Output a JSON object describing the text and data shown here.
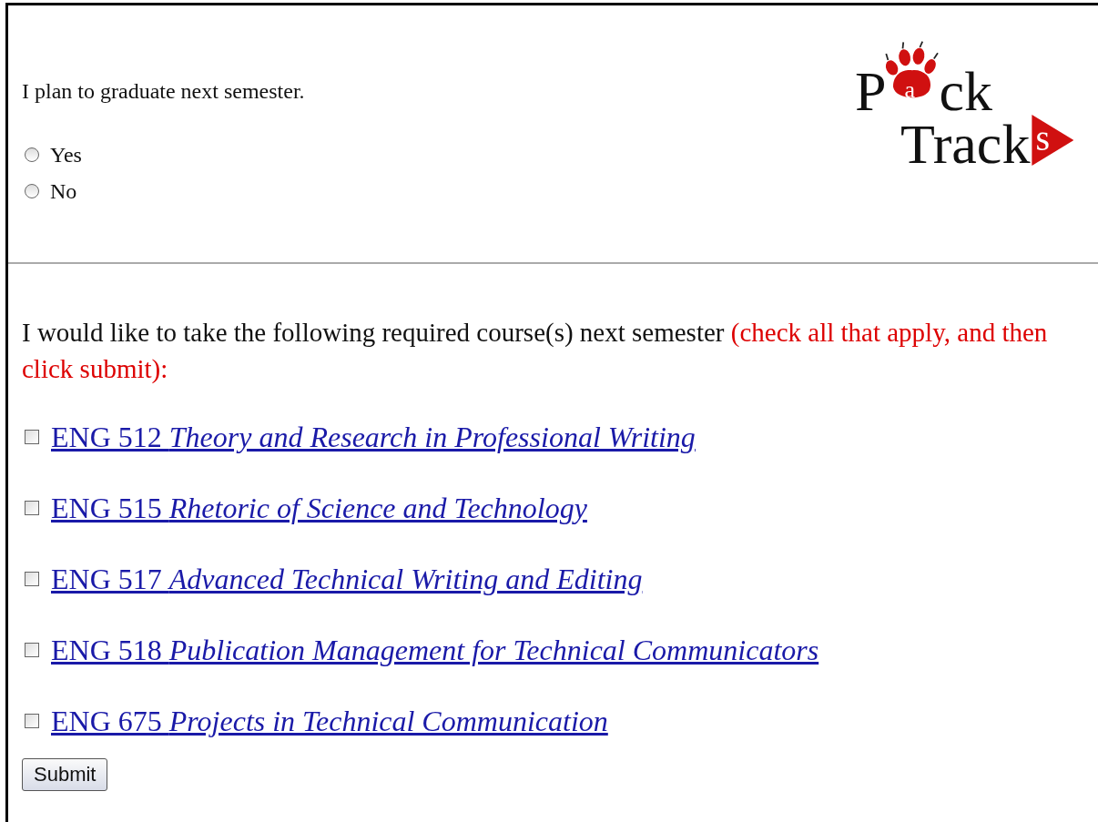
{
  "question": {
    "text": "I plan to graduate next semester.",
    "options": [
      {
        "label": "Yes",
        "selected": false
      },
      {
        "label": "No",
        "selected": false
      }
    ]
  },
  "logo": {
    "line_1": [
      "P",
      "a",
      "ck"
    ],
    "line_2": [
      "Track",
      "s"
    ]
  },
  "course_prompt": {
    "text": "I would like to take the following required course(s) next semester",
    "note": "(check all that apply, and then click submit):"
  },
  "courses": [
    {
      "code": "ENG 512",
      "title": "Theory and Research in Professional Writing",
      "checked": false
    },
    {
      "code": "ENG 515",
      "title": "Rhetoric of Science and Technology",
      "checked": false
    },
    {
      "code": "ENG 517",
      "title": "Advanced Technical Writing and Editing",
      "checked": false
    },
    {
      "code": "ENG 518",
      "title": "Publication Management for Technical Communicators",
      "checked": false
    },
    {
      "code": "ENG 675",
      "title": "Projects in Technical Communication",
      "checked": false
    }
  ],
  "submit_button": "Submit"
}
